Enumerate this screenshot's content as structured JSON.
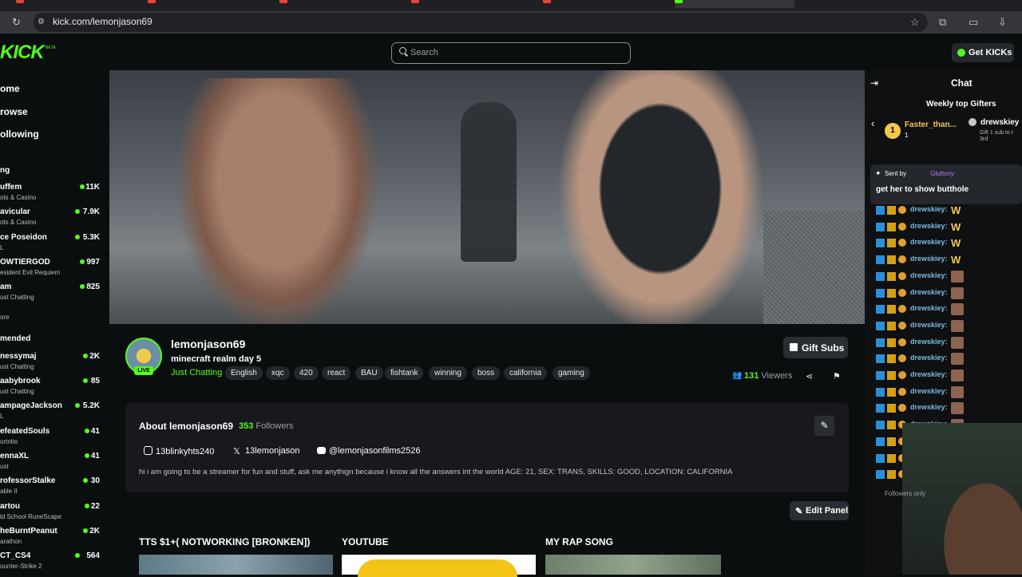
{
  "browser": {
    "url": "kick.com/lemonjason69",
    "tabs": [
      {
        "label": "...",
        "color": "#ea4335"
      },
      {
        "label": "...",
        "color": "#ea4335"
      },
      {
        "label": "...",
        "color": "#ea4335"
      },
      {
        "label": "...",
        "color": "#ea4335"
      },
      {
        "label": "...",
        "color": "#ea4335"
      },
      {
        "label": "...",
        "color": "#53fc18"
      }
    ]
  },
  "site": {
    "logo": "KICK",
    "logo_beta": "BETA",
    "search_placeholder": "Search",
    "get_kicks": "Get KICKs",
    "accent": "#53fc18"
  },
  "sidebar": {
    "nav": [
      "ome",
      "rowse",
      "ollowing"
    ],
    "following_title": "ng",
    "following": [
      {
        "name": "uffem",
        "category": "ots & Casino",
        "viewers": "11K"
      },
      {
        "name": "avicular",
        "category": "ots & Casino",
        "viewers": "7.9K"
      },
      {
        "name": "ce Poseidon",
        "category": "L",
        "viewers": "5.3K"
      },
      {
        "name": "OWTIERGOD",
        "category": "esident Evil Requiem",
        "viewers": "997"
      },
      {
        "name": "am",
        "category": "ust Chatting",
        "viewers": "825"
      }
    ],
    "show_more_1": "ore",
    "recommended_title": "mended",
    "recommended": [
      {
        "name": "nessymaj",
        "category": "ust Chatting",
        "viewers": "2K"
      },
      {
        "name": "aabybrook",
        "category": "ust Chatting",
        "viewers": "85"
      },
      {
        "name": "ampageJackson",
        "category": "L",
        "viewers": "5.2K"
      },
      {
        "name": "efeatedSouls",
        "category": "ortnite",
        "viewers": "41"
      },
      {
        "name": "ennaXL",
        "category": "ust",
        "viewers": "41"
      },
      {
        "name": "rofessorStalke",
        "category": "able II",
        "viewers": "30"
      },
      {
        "name": "artou",
        "category": "ld School RuneScape",
        "viewers": "22"
      },
      {
        "name": "heBurntPeanut",
        "category": "arathon",
        "viewers": "2K"
      },
      {
        "name": "CT_CS4",
        "category": "ounter-Strike 2",
        "viewers": "564"
      }
    ]
  },
  "channel": {
    "name": "lemonjason69",
    "live_badge": "LIVE",
    "stream_title": "minecraft realm day 5",
    "category": "Just Chatting",
    "tags": [
      "English",
      "xqc",
      "420",
      "react",
      "BAU",
      "fishtank",
      "winning",
      "boss",
      "california",
      "gaming"
    ],
    "gift_subs": "Gift Subs",
    "viewers_count": "131",
    "viewers_label": "Viewers"
  },
  "about": {
    "title": "About lemonjason69",
    "followers_count": "353",
    "followers_label": "Followers",
    "socials": [
      {
        "platform": "instagram-icon",
        "handle": "13blinkyhts240"
      },
      {
        "platform": "x-icon",
        "handle": "13lemonjason"
      },
      {
        "platform": "youtube-icon",
        "handle": "@lemonjasonfilms2526"
      }
    ],
    "bio": "hi i am going to be a streamer for fun and stuff, ask me anythign because i know all the answers int the world AGE: 21, SEX: TRANS, SKILLS: GOOD, LOCATION: CALIFORNIA",
    "edit_panel": "Edit Panel"
  },
  "panels": [
    {
      "title": "TTS $1+( NOTWORKING [BRONKEN])"
    },
    {
      "title": "YOUTUBE"
    },
    {
      "title": "MY RAP SONG"
    }
  ],
  "chat": {
    "title": "Chat",
    "weekly_gifters_title": "Weekly top Gifters",
    "gifter1": {
      "rank": "1",
      "name": "Faster_than...",
      "count": "1"
    },
    "gifter2": {
      "name": "drewskiey",
      "sub": "Gift 1 sub to t",
      "rank_label": "3rd"
    },
    "pinned_label": "Sent by",
    "pinned_user": "Gluttony",
    "pinned_message": "get her to show butthole",
    "messages": [
      {
        "user": "drewskiey:",
        "emote": "W"
      },
      {
        "user": "drewskiey:",
        "emote": "W"
      },
      {
        "user": "drewskiey:",
        "emote": "W"
      },
      {
        "user": "drewskiey:",
        "emote": "W"
      },
      {
        "user": "drewskiey:",
        "emote": "face"
      },
      {
        "user": "drewskiey:",
        "emote": "face"
      },
      {
        "user": "drewskiey:",
        "emote": "face"
      },
      {
        "user": "drewskiey:",
        "emote": "face"
      },
      {
        "user": "drewskiey:",
        "emote": "face"
      },
      {
        "user": "drewskiey:",
        "emote": "face"
      },
      {
        "user": "drewskiey:",
        "emote": "face"
      },
      {
        "user": "drewskiey:",
        "emote": "face"
      },
      {
        "user": "drewskiey:",
        "emote": "face"
      },
      {
        "user": "drewskiey:",
        "emote": "face"
      },
      {
        "user": "drewskiey:",
        "emote": "face"
      },
      {
        "user": "drewskiey:",
        "emote": "face"
      },
      {
        "user": "drewskiey:",
        "emote": "face"
      }
    ],
    "followers_only": "Followers only"
  }
}
